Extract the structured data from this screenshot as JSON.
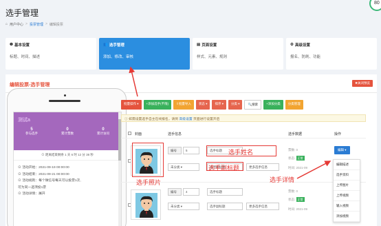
{
  "page": {
    "title": "选手管理"
  },
  "breadcrumb": [
    "用户中心",
    "投票管理",
    "编辑投票"
  ],
  "corner_badge": "80",
  "cards": [
    {
      "title": "基本设置",
      "desc": "标题、时间、描述",
      "icon": "info-icon",
      "active": false
    },
    {
      "title": "选手管理",
      "desc": "添加、修改、审核",
      "icon": "users-icon",
      "active": true
    },
    {
      "title": "页面设置",
      "desc": "样式、元素、规则",
      "icon": "page-icon",
      "active": false
    },
    {
      "title": "高级设置",
      "desc": "报名、防刷、功能",
      "icon": "gear-icon",
      "active": false
    }
  ],
  "main": {
    "title": "编辑投票-选手管理",
    "close_label": "关闭预览"
  },
  "phone": {
    "name": "测试a",
    "stats": [
      {
        "n": "5",
        "l": "参与选手"
      },
      {
        "n": "0",
        "l": "累计票数"
      },
      {
        "n": "0",
        "l": "累计访问"
      }
    ],
    "countdown": "距离结束剩余 1 天 6 时 12 分 38 秒",
    "info": [
      "活动开始：2021-09-19 00:00:00",
      "活动结束：2021-09-21 00:00:00",
      "活动规则：每个微信号每天可以投票1次,",
      "可为同一选项投1票",
      "活动详情：展开"
    ]
  },
  "toolbar": [
    {
      "label": "批量操作",
      "color": "red"
    },
    {
      "label": "添加选手(不限)",
      "color": "green"
    },
    {
      "label": "批量导入",
      "color": "orange"
    },
    {
      "label": "状态",
      "color": "lred"
    },
    {
      "label": "排序",
      "color": "lred"
    },
    {
      "label": "分类",
      "color": "lred"
    },
    {
      "label": "搜索",
      "color": "white"
    },
    {
      "label": "添加分类",
      "color": "green"
    },
    {
      "label": "分类管理",
      "color": "orange"
    }
  ],
  "notice": {
    "text": "如需设置选手自主在线报名，请到",
    "link": "高级设置",
    "tail": "页面进行设置开启"
  },
  "table": {
    "headers": [
      "封面",
      "选手信息",
      "选手数据",
      "操作"
    ],
    "rows": [
      {
        "num_label": "编号",
        "num": "5",
        "title_placeholder": "选手标题",
        "category": "未分类",
        "subtitle_placeholder": "选手副标题",
        "more_placeholder": "更多选手信息",
        "votes": "票数: 0",
        "status_label": "状态:",
        "status": "正常",
        "time": "时间: 2021-09",
        "edit": "编辑"
      },
      {
        "num_label": "编号",
        "num": "4",
        "title_placeholder": "选手标题",
        "category": "未分类",
        "subtitle_placeholder": "选手副标题",
        "more_placeholder": "更多选手信息",
        "votes": "票数: 0",
        "status_label": "状态:",
        "status": "正常",
        "time": "时间: 2021-09",
        "edit": "编辑"
      }
    ]
  },
  "edit_menu": [
    "编辑描述",
    "选手资料",
    "上传图片",
    "上传视频",
    "输入视频",
    "添加视频"
  ],
  "annotations": {
    "photo": "选手照片",
    "name": "选手姓名",
    "subtitle": "选手副标题",
    "detail": "选手详情"
  }
}
